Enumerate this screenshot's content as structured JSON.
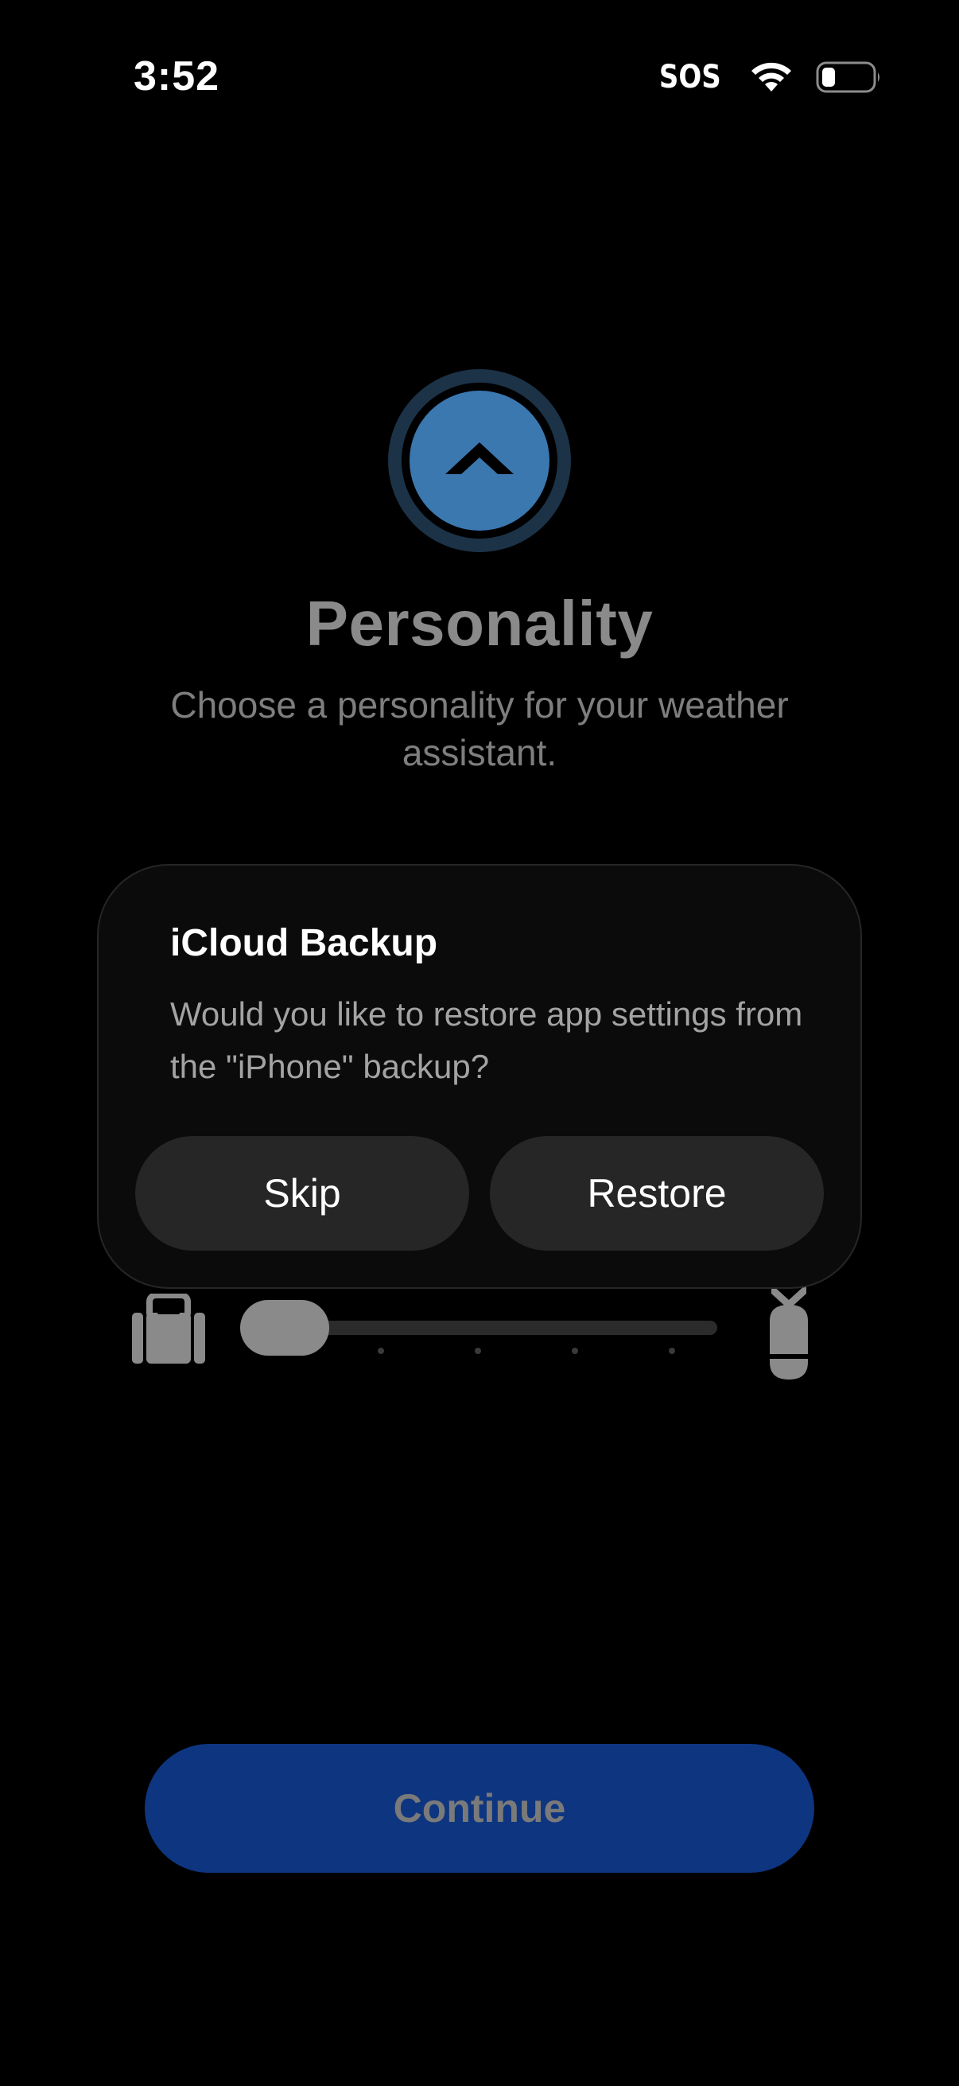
{
  "status_bar": {
    "time": "3:52",
    "sos": "SOS",
    "icons": [
      "wifi-icon",
      "battery-icon"
    ]
  },
  "header": {
    "icon": "chevron-up-icon",
    "title": "Personality",
    "subtitle": "Choose a personality for your weather assistant."
  },
  "dialog": {
    "title": "iCloud Backup",
    "message": "Would you like to restore app settings from the \"iPhone\" backup?",
    "skip_label": "Skip",
    "restore_label": "Restore"
  },
  "slider": {
    "left_icon": "luggage-icon",
    "right_icon": "bomb-icon",
    "value": 0,
    "steps": 5
  },
  "footer": {
    "continue_label": "Continue"
  },
  "colors": {
    "background": "#000000",
    "accent": "#0e3580",
    "icon_blue": "#3b78b0",
    "dialog_bg": "#0b0b0b",
    "dialog_button": "#262626"
  }
}
